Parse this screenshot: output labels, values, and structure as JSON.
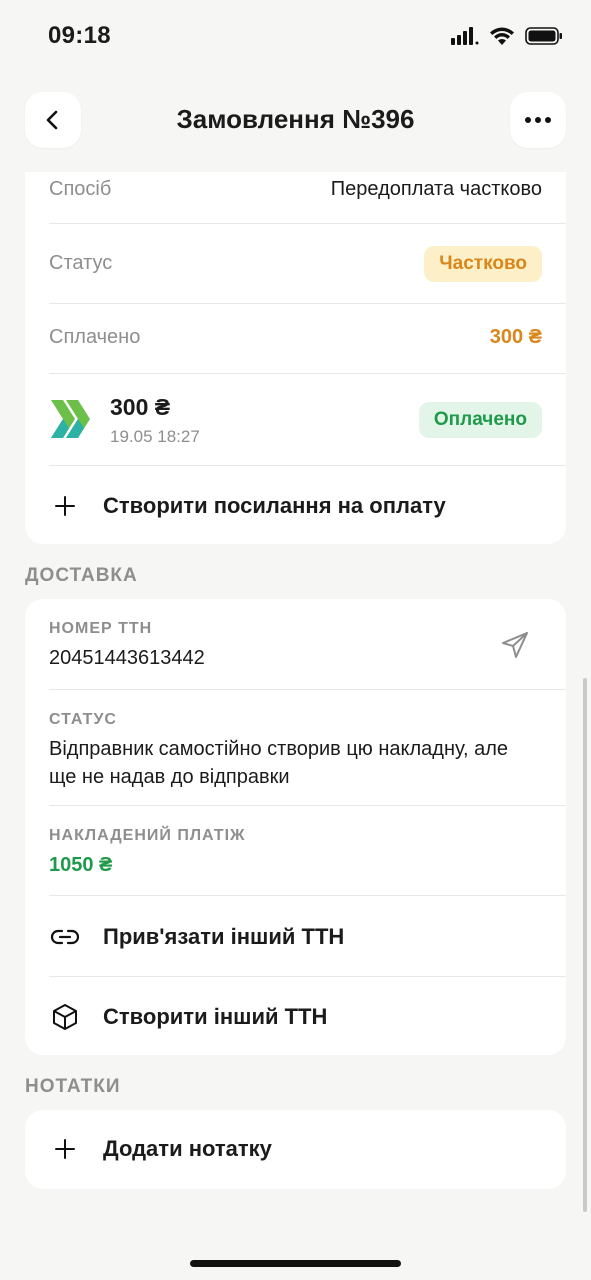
{
  "status_bar": {
    "time": "09:18"
  },
  "header": {
    "title": "Замовлення №396"
  },
  "payment": {
    "method_label": "Спосіб",
    "method_value": "Передоплата частково",
    "status_label": "Статус",
    "status_value": "Частково",
    "paid_label": "Сплачено",
    "paid_value": "300 ₴",
    "transaction": {
      "amount": "300 ₴",
      "datetime": "19.05 18:27",
      "status": "Оплачено"
    },
    "create_link_label": "Створити посилання на оплату"
  },
  "delivery": {
    "section_title": "ДОСТАВКА",
    "ttn_label": "НОМЕР ТТН",
    "ttn_value": "20451443613442",
    "status_label": "СТАТУС",
    "status_value": "Відправник самостійно створив цю накладну, але ще не надав до відправки",
    "cod_label": "НАКЛАДЕНИЙ ПЛАТІЖ",
    "cod_value": "1050 ₴",
    "link_other_label": "Прив'язати інший ТТН",
    "create_other_label": "Створити інший ТТН"
  },
  "notes": {
    "section_title": "НОТАТКИ",
    "add_label": "Додати нотатку"
  },
  "colors": {
    "accent_orange": "#d9861a",
    "badge_orange_bg": "#fdf0c8",
    "paid_green": "#1f9a4a",
    "badge_green_bg": "#e3f5e8"
  }
}
